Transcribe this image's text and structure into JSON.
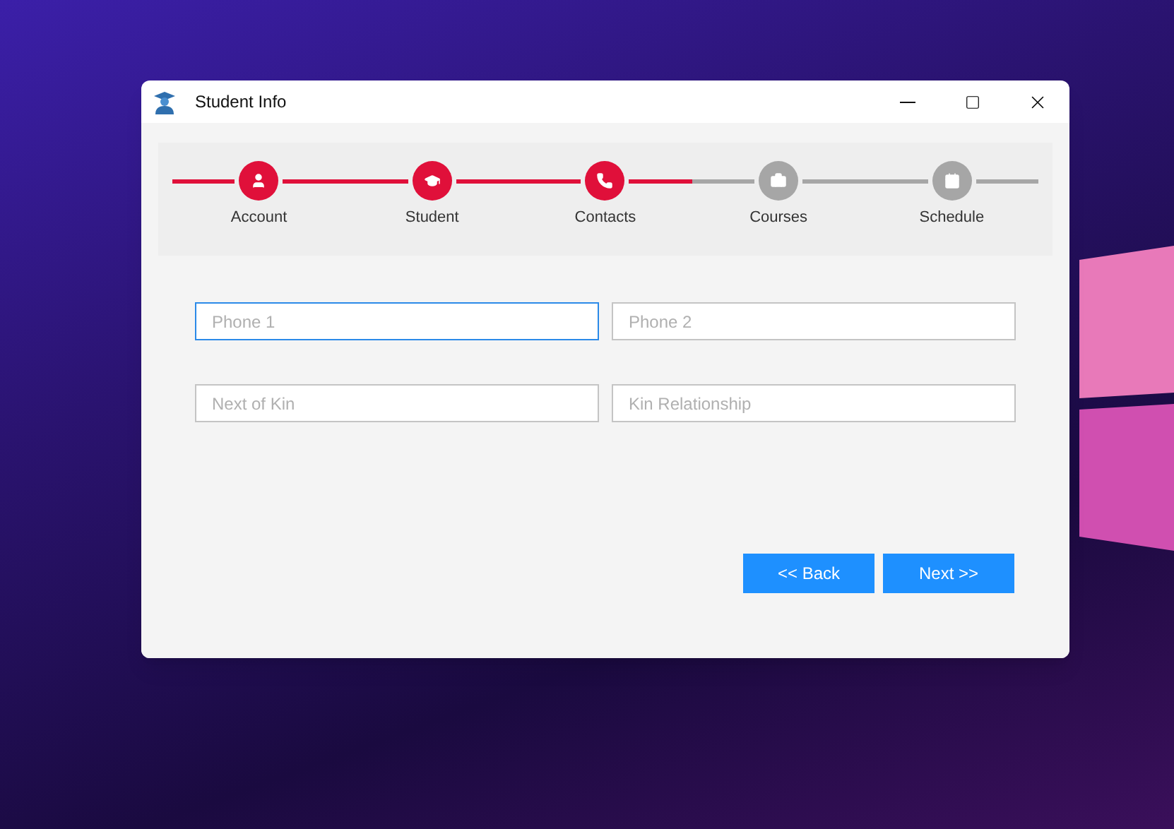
{
  "window": {
    "title": "Student Info"
  },
  "steps": [
    {
      "label": "Account",
      "completed": true,
      "kind": "account"
    },
    {
      "label": "Student",
      "completed": true,
      "kind": "student"
    },
    {
      "label": "Contacts",
      "completed": true,
      "kind": "contacts"
    },
    {
      "label": "Courses",
      "completed": false,
      "kind": "courses"
    },
    {
      "label": "Schedule",
      "completed": false,
      "kind": "schedule"
    }
  ],
  "fields": [
    {
      "placeholder": "Phone 1",
      "focused": true
    },
    {
      "placeholder": "Phone 2",
      "focused": false
    },
    {
      "placeholder": "Next of Kin",
      "focused": false
    },
    {
      "placeholder": "Kin Relationship",
      "focused": false
    }
  ],
  "buttons": [
    "<< Back",
    "Next >>"
  ]
}
